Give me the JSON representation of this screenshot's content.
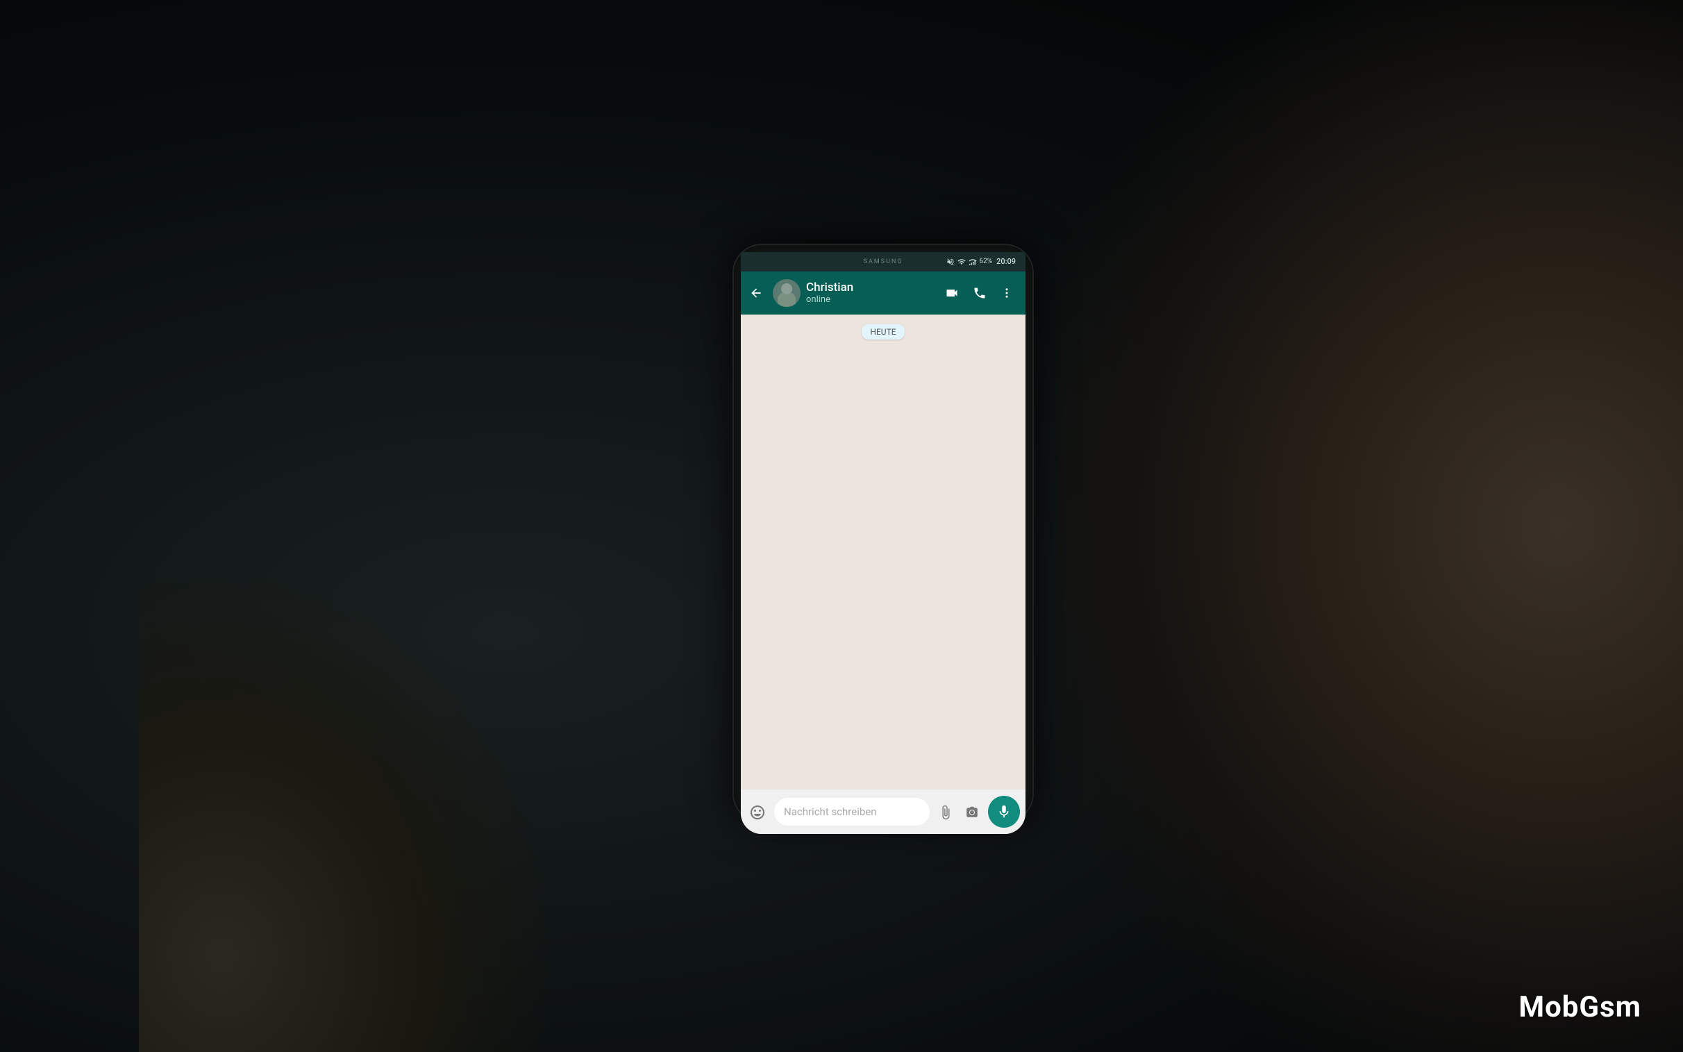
{
  "background": {
    "color": "#0a0e0f"
  },
  "watermark": {
    "text": "MobGsm"
  },
  "phone": {
    "brand": "SAMSUNG"
  },
  "status_bar": {
    "mute_icon": "🔇",
    "wifi_icon": "wifi",
    "signal_icon": "signal",
    "battery": "62%",
    "time": "20:09"
  },
  "wa_header": {
    "back_label": "←",
    "contact_name": "Christian",
    "contact_status": "online",
    "video_call_icon": "video-camera",
    "phone_icon": "phone",
    "menu_icon": "more-vertical"
  },
  "wa_chat": {
    "date_badge": "HEUTE"
  },
  "wa_input": {
    "emoji_icon": "emoji",
    "placeholder": "Nachricht schreiben",
    "attach_icon": "paperclip",
    "camera_icon": "camera",
    "mic_icon": "microphone"
  }
}
